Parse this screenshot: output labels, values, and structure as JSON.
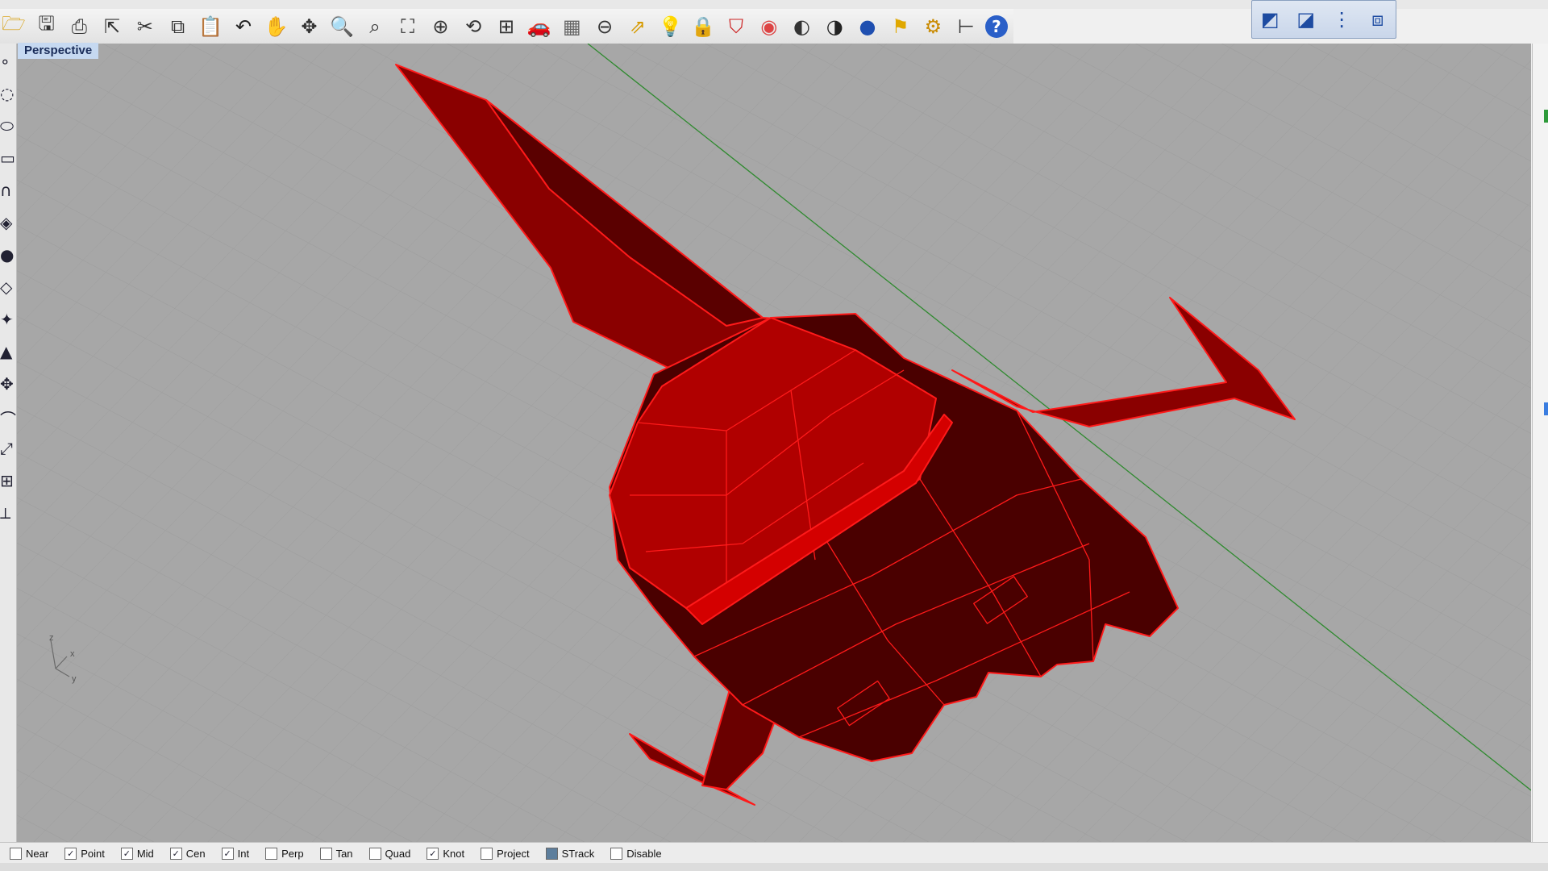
{
  "viewport": {
    "title": "Perspective",
    "bg_color": "#a7a7a7",
    "model_color": "#cc0000"
  },
  "toolbar": {
    "icons": [
      {
        "name": "open-icon",
        "glyph": "🗁",
        "color": "#d69a00"
      },
      {
        "name": "save-icon",
        "glyph": "🖫",
        "color": "#333"
      },
      {
        "name": "print-icon",
        "glyph": "⎙",
        "color": "#333"
      },
      {
        "name": "export-icon",
        "glyph": "⇱",
        "color": "#333"
      },
      {
        "name": "cut-icon",
        "glyph": "✂",
        "color": "#333"
      },
      {
        "name": "copy-icon",
        "glyph": "⧉",
        "color": "#333"
      },
      {
        "name": "paste-icon",
        "glyph": "📋",
        "color": "#c79a2a"
      },
      {
        "name": "undo-icon",
        "glyph": "↶",
        "color": "#222"
      },
      {
        "name": "pan-icon",
        "glyph": "✋",
        "color": "#333"
      },
      {
        "name": "rotate-view-icon",
        "glyph": "✥",
        "color": "#333"
      },
      {
        "name": "zoom-icon",
        "glyph": "🔍",
        "color": "#333"
      },
      {
        "name": "zoom-window-icon",
        "glyph": "⌕",
        "color": "#333"
      },
      {
        "name": "zoom-extents-icon",
        "glyph": "⛶",
        "color": "#333"
      },
      {
        "name": "zoom-selected-icon",
        "glyph": "⊕",
        "color": "#333"
      },
      {
        "name": "undo-view-icon",
        "glyph": "⟲",
        "color": "#333"
      },
      {
        "name": "four-viewports-icon",
        "glyph": "⊞",
        "color": "#333"
      },
      {
        "name": "car-icon",
        "glyph": "🚗",
        "color": "#c22"
      },
      {
        "name": "grid-plane-icon",
        "glyph": "▦",
        "color": "#666"
      },
      {
        "name": "point-icon",
        "glyph": "⊖",
        "color": "#333"
      },
      {
        "name": "move-icon",
        "glyph": "⇗",
        "color": "#d69a00"
      },
      {
        "name": "light-icon",
        "glyph": "💡",
        "color": "#888"
      },
      {
        "name": "lock-icon",
        "glyph": "🔒",
        "color": "#555"
      },
      {
        "name": "layer-icon",
        "glyph": "⛉",
        "color": "#c22"
      },
      {
        "name": "color-wheel-icon",
        "glyph": "◉",
        "color": "#d44"
      },
      {
        "name": "material-sphere-icon",
        "glyph": "◐",
        "color": "#333"
      },
      {
        "name": "render-sphere-icon",
        "glyph": "◑",
        "color": "#222"
      },
      {
        "name": "blue-sphere-icon",
        "glyph": "●",
        "color": "#1f4fb0"
      },
      {
        "name": "flag-icon",
        "glyph": "⚑",
        "color": "#e0a800"
      },
      {
        "name": "settings-icon",
        "glyph": "⚙",
        "color": "#c98a00"
      },
      {
        "name": "dimension-icon",
        "glyph": "⊢",
        "color": "#333"
      },
      {
        "name": "help-icon",
        "glyph": "?",
        "color": "#fff"
      }
    ]
  },
  "view_toolbar": {
    "icons": [
      {
        "name": "view-3d-icon",
        "glyph": "◩"
      },
      {
        "name": "view-top-icon",
        "glyph": "◪"
      },
      {
        "name": "view-front-icon",
        "glyph": "⋮"
      },
      {
        "name": "view-right-icon",
        "glyph": "⧈"
      }
    ]
  },
  "left_toolbar": {
    "icons": [
      "point-tool-icon",
      "circle-tool-icon",
      "ellipse-tool-icon",
      "rectangle-tool-icon",
      "arc-tool-icon",
      "surface-tool-icon",
      "sphere-tool-icon",
      "loft-tool-icon",
      "explode-tool-icon",
      "extrude-tool-icon",
      "move-tool-icon",
      "curve-tool-icon",
      "transform-tool-icon",
      "dimension-tool-icon",
      "analyze-tool-icon"
    ]
  },
  "axis_labels": {
    "z": "z",
    "x": "x",
    "y": "y"
  },
  "status": {
    "snaps": [
      {
        "label": "Near",
        "checked": false
      },
      {
        "label": "Point",
        "checked": true
      },
      {
        "label": "Mid",
        "checked": true
      },
      {
        "label": "Cen",
        "checked": true
      },
      {
        "label": "Int",
        "checked": true
      },
      {
        "label": "Perp",
        "checked": false
      },
      {
        "label": "Tan",
        "checked": false
      },
      {
        "label": "Quad",
        "checked": false
      },
      {
        "label": "Knot",
        "checked": true
      },
      {
        "label": "Project",
        "checked": false
      },
      {
        "label": "STrack",
        "checked": false,
        "filled": true
      },
      {
        "label": "Disable",
        "checked": false
      }
    ]
  }
}
